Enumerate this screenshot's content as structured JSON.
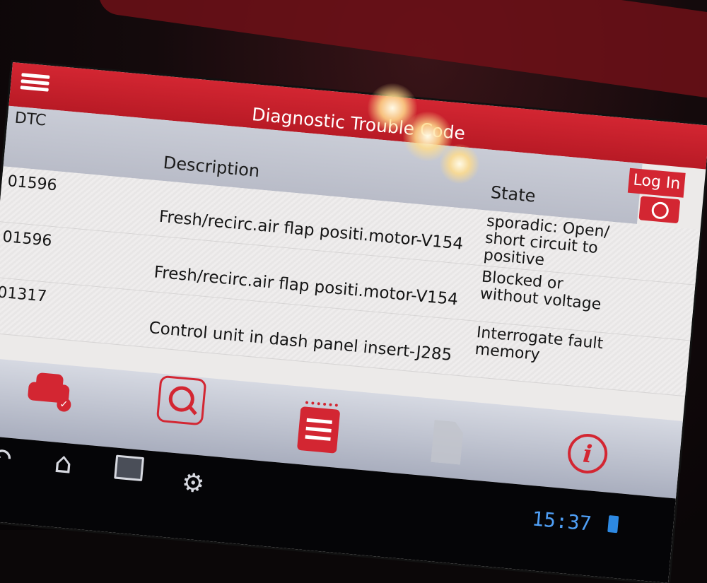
{
  "header": {
    "title": "Diagnostic Trouble Code",
    "login_label": "Log In"
  },
  "columns": {
    "dtc": "DTC",
    "description": "Description",
    "state": "State"
  },
  "rows": [
    {
      "code": "01596",
      "description": "Fresh/recirc.air flap positi.motor-V154",
      "state": "sporadic: Open/ short circuit to positive"
    },
    {
      "code": "01596",
      "description": "Fresh/recirc.air flap positi.motor-V154",
      "state": "Blocked or without voltage"
    },
    {
      "code": "01317",
      "description": "Control unit in dash panel insert-J285",
      "state": "Interrogate fault memory"
    }
  ],
  "toolbar": {
    "icons": [
      "car-check-icon",
      "search-icon",
      "report-icon",
      "document-icon",
      "info-icon"
    ],
    "info_glyph": "i",
    "check_glyph": "✓"
  },
  "navbar": {
    "back_glyph": "↶",
    "home_glyph": "⌂",
    "settings_glyph": "⚙",
    "time": "15:37"
  },
  "colors": {
    "accent": "#d32632",
    "header_row": "#c0c3ce",
    "clock": "#4f9ff5"
  }
}
